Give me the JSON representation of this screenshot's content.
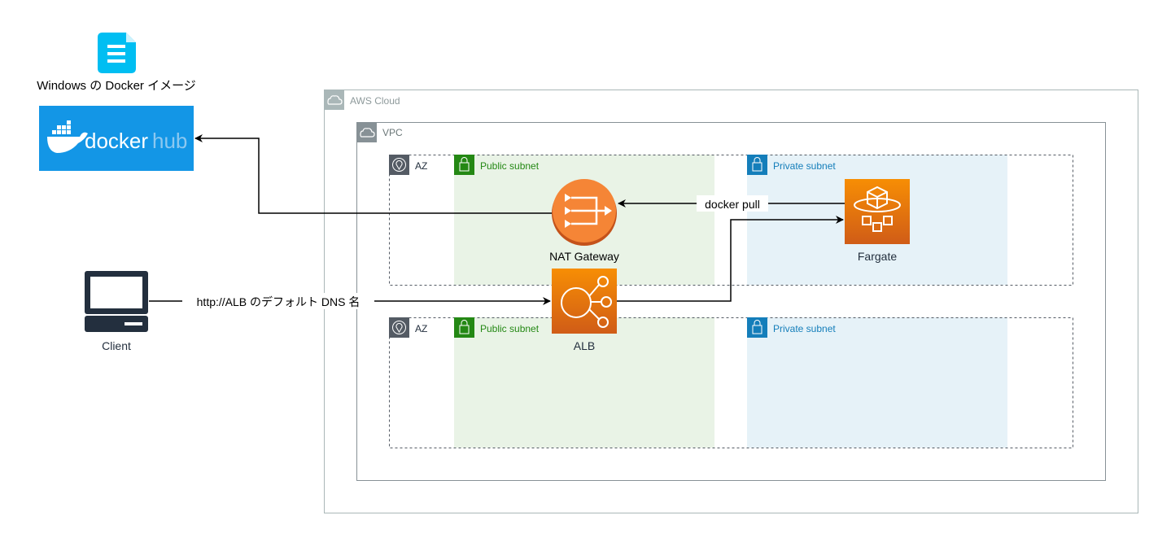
{
  "image_label": "Windows の Docker イメージ",
  "dockerhub": {
    "logo_text_docker": "docker",
    "logo_text_hub": "hub",
    "color": "#1396e6"
  },
  "groups": {
    "aws_cloud": "AWS Cloud",
    "vpc": "VPC",
    "az": [
      "AZ",
      "AZ"
    ],
    "public_subnet": [
      "Public subnet",
      "Public subnet"
    ],
    "private_subnet": [
      "Private subnet",
      "Private subnet"
    ]
  },
  "nodes": {
    "nat": "NAT Gateway",
    "fargate": "Fargate",
    "alb": "ALB",
    "client": "Client"
  },
  "edges": {
    "docker_pull": "docker pull",
    "client_to_alb": "http://ALB のデフォルト DNS 名"
  },
  "colors": {
    "public_fill": "#e9f3e6",
    "private_fill": "#e6f2f8",
    "public_green": "#248814",
    "private_blue": "#147eba",
    "aws_orange": "#ed7100"
  }
}
